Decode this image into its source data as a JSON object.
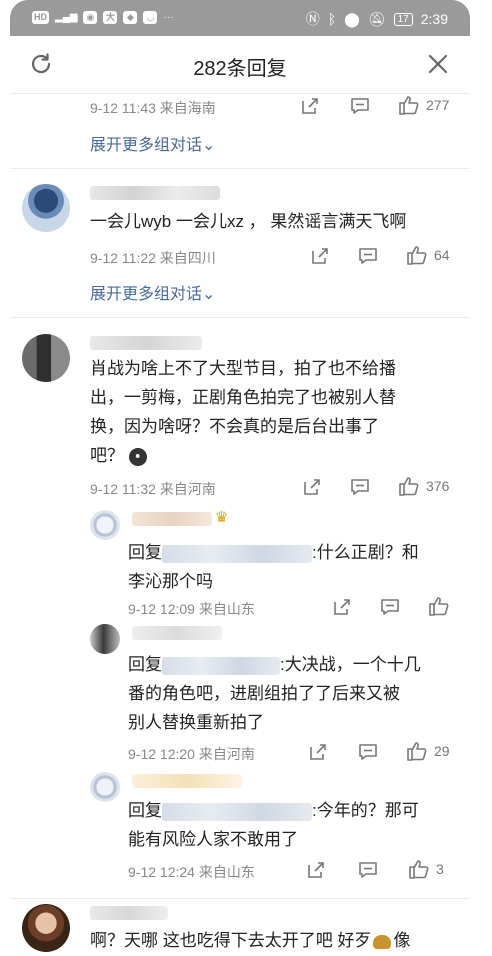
{
  "statusbar": {
    "left_text": "HD 4G",
    "time": "2:39",
    "battery": "17"
  },
  "header": {
    "title": "282条回复"
  },
  "comments": [
    {
      "meta": "9-12 11:43 来自海南",
      "likes": "277",
      "expand": "展开更多组对话⌄"
    },
    {
      "text": "一会儿wyb 一会儿xz ， 果然谣言满天飞啊",
      "meta": "9-12 11:22 来自四川",
      "likes": "64",
      "expand": "展开更多组对话⌄"
    },
    {
      "lines": [
        "肖战为啥上不了大型节目，拍了也不给播",
        "出，一剪梅，正剧角色拍完了也被别人替",
        "换，因为啥呀？不会真的是后台出事了",
        "吧？"
      ],
      "meta": "9-12 11:32 来自河南",
      "likes": "376",
      "replies": [
        {
          "prefix": "回复",
          "line1_tail": ":什么正剧？和",
          "line2": "李沁那个吗",
          "meta": "9-12 12:09 来自山东",
          "likes": ""
        },
        {
          "prefix": "回复",
          "line1_tail": ":大决战，一个十几",
          "line2": "番的角色吧，进剧组拍了了后来又被",
          "line3": "别人替换重新拍了",
          "meta": "9-12 12:20 来自河南",
          "likes": "29"
        },
        {
          "prefix": "回复",
          "line1_tail": ":今年的？那可",
          "line2": "能有风险人家不敢用了",
          "meta": "9-12 12:24 来自山东",
          "likes": "3"
        }
      ]
    },
    {
      "text": "啊？天哪 这也吃得下去太开了吧 好歹",
      "text_tail": "像"
    }
  ],
  "icons": {
    "refresh": "refresh-icon",
    "close": "close-icon",
    "share": "share-icon",
    "comment": "comment-icon",
    "like": "thumbs-up-icon"
  },
  "colors": {
    "link": "#4a6a9a",
    "meta": "#888888",
    "statusbar": "#9a9a9a"
  }
}
